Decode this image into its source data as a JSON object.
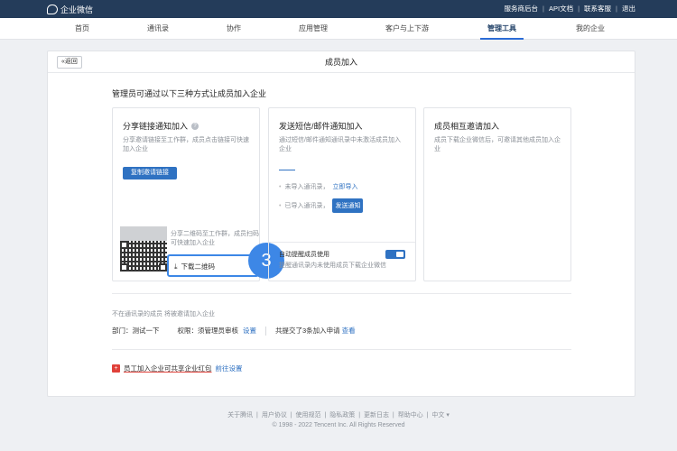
{
  "topbar": {
    "brand": "企业微信",
    "links": [
      "服务商后台",
      "API文档",
      "联系客服",
      "退出"
    ]
  },
  "nav": {
    "items": [
      "首页",
      "通讯录",
      "协作",
      "应用管理",
      "客户与上下游",
      "管理工具",
      "我的企业"
    ],
    "active": "管理工具"
  },
  "page": {
    "back_label": "«返回",
    "title": "成员加入",
    "intro": "管理员可通过以下三种方式让成员加入企业"
  },
  "option1": {
    "title": "分享链接通知加入",
    "help_icon": "?",
    "desc": "分享邀请链接至工作群，成员点击链接可快速加入企业",
    "copy_button": "复制邀请链接",
    "step_number": "3",
    "qr_desc": "分享二维码至工作群，成员扫码可快速加入企业",
    "download_label": "下载二维码",
    "download_icon": "⤓"
  },
  "option2": {
    "title": "发送短信/邮件通知加入",
    "desc": "通过短信/邮件通知通讯录中未激活成员加入企业",
    "row1_text": "未导入通讯录，",
    "row1_link": "立即导入",
    "row2_text": "已导入通讯录，",
    "row2_button": "发送通知",
    "toggle_label": "自动提醒成员使用",
    "toggle_desc": "提醒通讯录内未使用成员下载企业微信",
    "toggle_on": true
  },
  "option3": {
    "title": "成员相互邀请加入",
    "desc": "成员下载企业微信后，可邀请其他成员加入企业"
  },
  "invite_settings": {
    "section_label": "不在通讯录的成员 将被邀请加入企业",
    "dept_label": "部门：",
    "dept_value": "测试一下",
    "perm_label": "权限：",
    "perm_value": "须管理员审核",
    "perm_link": "设置",
    "count_text": "共提交了3条加入申请",
    "count_link": "查看"
  },
  "red_packet": {
    "icon": "+",
    "text": "员工加入企业可共享企业红包",
    "link": "前往设置"
  },
  "footer": {
    "links": [
      "关于腾讯",
      "用户协议",
      "使用规范",
      "隐私政策",
      "更新日志",
      "帮助中心",
      "中文 ▾"
    ],
    "copyright": "© 1998 - 2022 Tencent Inc. All Rights Reserved"
  },
  "colors": {
    "topbar": "#243c5a",
    "accent": "#2f72c2",
    "highlight": "#3d87e6",
    "red": "#e0413a"
  }
}
